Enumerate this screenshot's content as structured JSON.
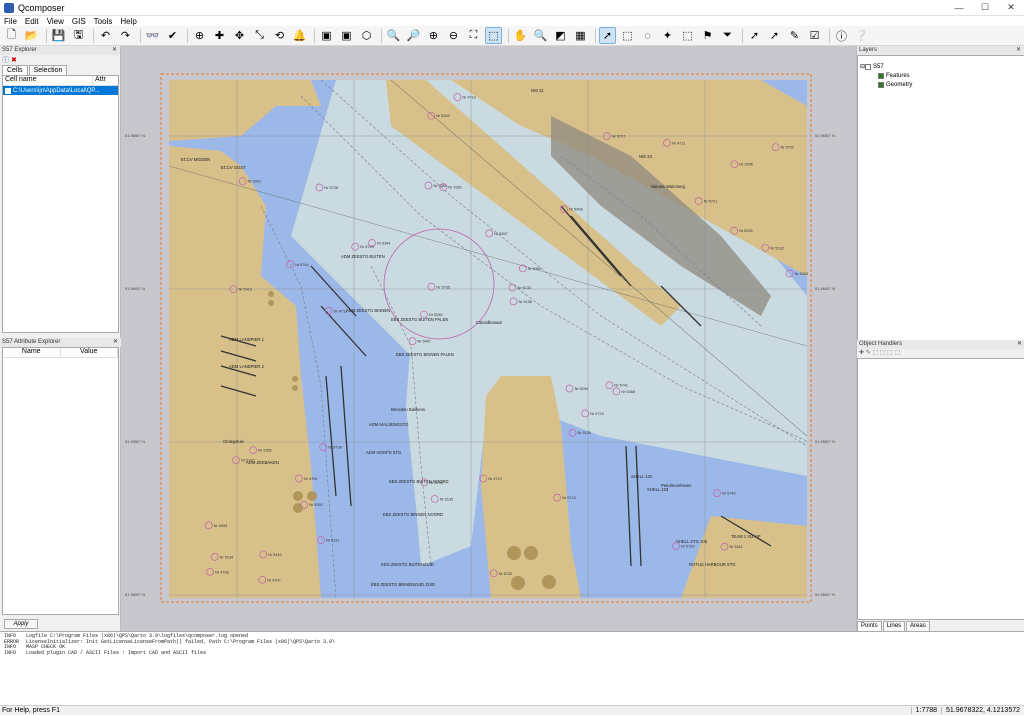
{
  "window": {
    "title": "Qcomposer",
    "controls": [
      "—",
      "☐",
      "✕"
    ]
  },
  "menu": [
    "File",
    "Edit",
    "View",
    "GIS",
    "Tools",
    "Help"
  ],
  "toolbar": {
    "icons": [
      "new-file-icon",
      "open-folder-icon",
      "save-icon",
      "save-all-icon",
      "undo-icon",
      "redo-icon",
      "binoculars-icon",
      "check-icon",
      "add-point-icon",
      "add-node-icon",
      "move-icon",
      "scale-icon",
      "rotate-icon",
      "alarm-bell-icon",
      "red-feature-icon",
      "green-feature-icon",
      "navigation-icon",
      "zoom-in-icon",
      "zoom-out-icon",
      "zoom-in-2-icon",
      "zoom-out-2-icon",
      "zoom-extent-icon",
      "zoom-window-icon",
      "pan-icon",
      "magnify-icon",
      "layer-icon",
      "map-icon",
      "select-icon",
      "select-rect-icon",
      "select-lasso-icon",
      "wand-icon",
      "select-node-icon",
      "flag-icon",
      "filter-icon",
      "pointer-icon",
      "pointer-2-icon",
      "pen-icon",
      "checklist-icon",
      "info-icon",
      "help-pointer-icon"
    ],
    "glyphs": [
      "🗋",
      "📂",
      "💾",
      "🖫",
      "↶",
      "↷",
      "👓",
      "✔",
      "⊕",
      "✚",
      "✥",
      "⤡",
      "⟲",
      "🔔",
      "▣",
      "▣",
      "⬡",
      "🔍",
      "🔎",
      "⊕",
      "⊖",
      "⛶",
      "⬚",
      "✋",
      "🔍",
      "◩",
      "▦",
      "➚",
      "⬚",
      "◌",
      "✦",
      "⬚",
      "⚑",
      "⏷",
      "➚",
      "➚",
      "✎",
      "☑",
      "ⓘ",
      "❔"
    ],
    "active": [
      22,
      27
    ]
  },
  "left": {
    "explorer_title": "S57 Explorer",
    "tabs": [
      "Cells",
      "Selection"
    ],
    "columns": [
      "Cell name",
      "Attr"
    ],
    "rows": [
      "C:\\Users\\ijn\\AppData\\Local\\QP..."
    ],
    "attr_title": "S57 Attribute Explorer",
    "attr_columns": [
      "Name",
      "Value"
    ],
    "apply_label": "Apply"
  },
  "right": {
    "layers_title": "Layers",
    "tree": [
      {
        "label": "S57",
        "level": 0,
        "checked": false
      },
      {
        "label": "Features",
        "level": 1,
        "checked": true
      },
      {
        "label": "Geometry",
        "level": 1,
        "checked": true
      }
    ],
    "oh_title": "Object Handlers",
    "oh_tabs": [
      "Points",
      "Lines",
      "Areas"
    ]
  },
  "map": {
    "labels": [
      "ECCV MIDDEN",
      "ECCV OOST",
      "ADM ZEESTG BUITEN",
      "ADM ZEESTG BINNEN",
      "EBS ZEESTG BUITEN PALEN",
      "EBS ZEESTG BINNEN PALEN",
      "Calandkanaal",
      "Beneden Bakkens",
      "ADM MALSENGSTG",
      "ADM HOOFD STG",
      "EBS ZEESTG BUITEN NOORD",
      "EBS ZEESTG BINNEN NOORD",
      "EDS ZEESTG BUITENZUID",
      "EBS ZEESTG BINNENZUID ZUID",
      "ADM LANDPIER 1",
      "ADM LANDPIER 2",
      "ADM ZEEBAKEN",
      "Omlegsluis",
      "SHELL 101",
      "SHELL 103",
      "SHELL STG 105",
      "Nieuwe Waterweg",
      "Petroleumhaven",
      "ROTUS HARBOUR STG",
      "TEAM 1 VIZ VP",
      "NW 21",
      "NW 23"
    ],
    "buoys": [
      "Nr 5411",
      "Nr 5412",
      "Nr 5406",
      "Nr 5407",
      "Nr 5408",
      "Nr 5410",
      "Nr 5380",
      "Nr 5397",
      "Nr 5395",
      "Nr 5394",
      "Nr 5393",
      "Nr 5392",
      "Nr 5391",
      "Nr 5390",
      "Nr 5388",
      "Nr 5301",
      "Nr 5302",
      "Nr 5303",
      "Nr 5254",
      "Nr 5255",
      "Nr 5256",
      "Nr 5733",
      "Nr 5735",
      "Nr 5736",
      "Nr 5737",
      "Nr 5738",
      "Nr 5739",
      "Nr 5740",
      "Nr 5741",
      "Nr 5742",
      "Nr 5743",
      "Nr 5744",
      "Nr 5130",
      "Nr 5131",
      "Nr 5132",
      "Nr 5133",
      "Nr 5134",
      "Nr 5135",
      "Nr 5136",
      "Nr 5137",
      "Nr 5721",
      "Nr 5722",
      "Nr 5723",
      "Nr 5724",
      "Nr 4706",
      "Nr 4707",
      "Nr 4708",
      "Nr 4710",
      "Nr 4711",
      "Nr 4712",
      "Nr 4713"
    ],
    "lat_labels": [
      "51.9650° N",
      "51.9600° N",
      "51.9550° N",
      "51.9500° N",
      "51.9450° N"
    ]
  },
  "log": [
    {
      "lvl": "INFO",
      "msg": "Logfile C:\\Program Files (x86)\\QPS\\Qarto 3.0\\logfiles\\qcomposer.log opened"
    },
    {
      "lvl": "ERROR",
      "msg": "LicenseInitializer: Init GetLicenseLicenseFromPath() failed, Path C:\\Program Files (x86)\\QPS\\Qarto 3.0\\"
    },
    {
      "lvl": "INFO",
      "msg": "MASP CHECK OK"
    },
    {
      "lvl": "INFO",
      "msg": "Loaded plugin CAD / ASCII Files : Import CAD and ASCII files"
    }
  ],
  "status": {
    "help": "For Help, press F1",
    "scale": "1:7788",
    "coord": "51.9678322,  4.1213572"
  }
}
